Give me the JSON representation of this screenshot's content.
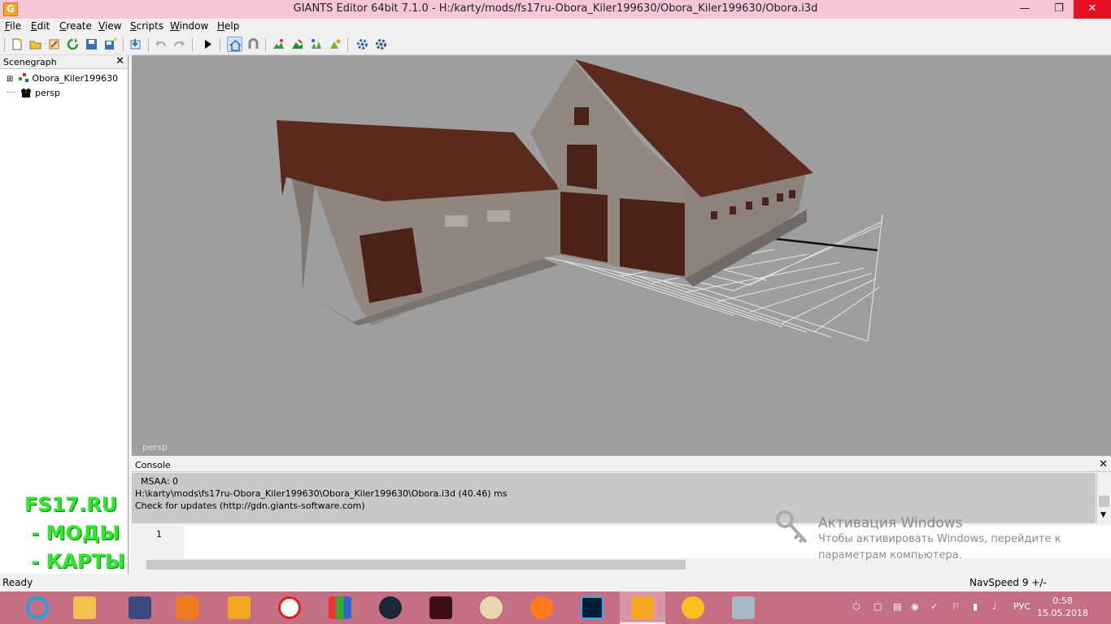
{
  "window": {
    "title": "GIANTS Editor 64bit 7.1.0 - H:/karty/mods/fs17ru-Obora_Kiler199630/Obora_Kiler199630/Obora.i3d",
    "app_icon_letter": "G",
    "minimize": "—",
    "restore": "❐",
    "close": "✕"
  },
  "menu": [
    {
      "first": "F",
      "rest": "ile"
    },
    {
      "first": "E",
      "rest": "dit"
    },
    {
      "first": "C",
      "rest": "reate"
    },
    {
      "first": "V",
      "rest": "iew"
    },
    {
      "first": "S",
      "rest": "cripts"
    },
    {
      "first": "W",
      "rest": "indow"
    },
    {
      "first": "H",
      "rest": "elp"
    }
  ],
  "scenegraph": {
    "title": "Scenegraph",
    "close": "✕",
    "items": [
      {
        "label": "Obora_Kiler199630",
        "expander": "⊞"
      },
      {
        "label": "persp"
      }
    ]
  },
  "viewport": {
    "camera_label": "persp"
  },
  "console": {
    "title": "Console",
    "close": "✕",
    "log": [
      "  MSAA: 0",
      "H:\\karty\\mods\\fs17ru-Obora_Kiler199630\\Obora_Kiler199630\\Obora.i3d (40.46) ms",
      "Check for updates (http://gdn.giants-software.com)"
    ],
    "input_line_number": "1"
  },
  "status": {
    "left": "Ready",
    "right": "NavSpeed 9 +/-"
  },
  "overlay_watermark": {
    "line1": "FS17.RU",
    "line2": " - МОДЫ",
    "line3": " - КАРТЫ"
  },
  "activation": {
    "title": "Активация Windows",
    "line1": "Чтобы активировать Windows, перейдите к",
    "line2": "параметрам компьютера."
  },
  "taskbar": {
    "apps": [
      "internet-explorer",
      "file-explorer",
      "app-3",
      "media-player",
      "giants-editor-pinned",
      "yandex-browser",
      "rubiks-cube",
      "steam",
      "app-9",
      "paint",
      "firefox",
      "photoshop",
      "giants-editor",
      "cloud-app",
      "system-monitor"
    ],
    "language": "РУС",
    "time": "0:58",
    "date": "15.05.2018"
  },
  "colors": {
    "titlebar": "#f7c6d6",
    "taskbar": "#c56f84",
    "viewport_bg": "#9e9e9e",
    "watermark_green": "#2ee82e"
  }
}
